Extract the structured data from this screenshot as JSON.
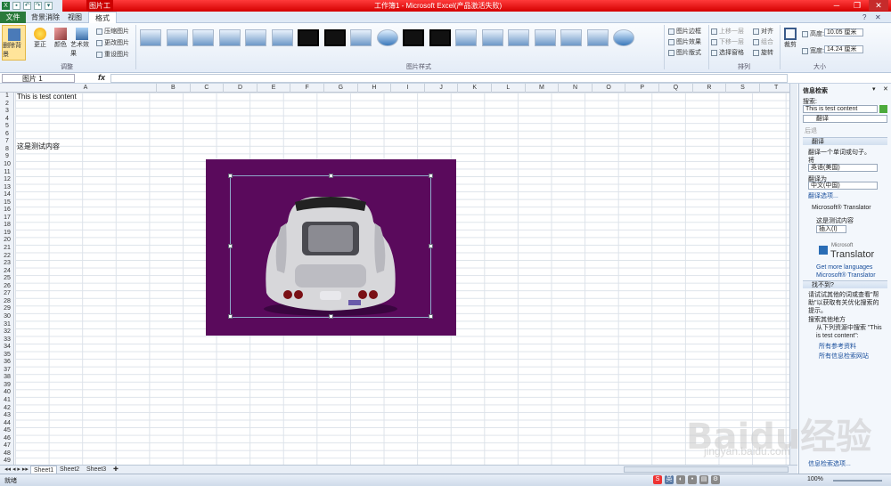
{
  "window": {
    "doc_title": "工作簿1 - Microsoft Excel(产品激活失败)",
    "context_tab": "图片工具"
  },
  "tabs": {
    "file": "文件",
    "bg_removal": "背景消除",
    "view": "视图",
    "format": "格式"
  },
  "ribbon": {
    "remove_bg": "删除背景",
    "corrections": "更正",
    "color": "颜色",
    "art_effects": "艺术效果",
    "compress": "压缩图片",
    "change": "更改图片",
    "reset": "重设图片",
    "adjust_group": "调整",
    "styles_group": "图片样式",
    "border": "图片边框",
    "effects": "图片效果",
    "layout": "图片版式",
    "bring_forward": "上移一层",
    "send_backward": "下移一层",
    "selection_pane": "选择窗格",
    "align": "对齐",
    "group": "组合",
    "rotate": "旋转",
    "arrange_group": "排列",
    "crop": "裁剪",
    "height_label": "高度:",
    "height_value": "10.05 厘米",
    "width_label": "宽度:",
    "width_value": "14.24 厘米",
    "size_group": "大小"
  },
  "formula": {
    "name_box": "图片 1",
    "fx": "fx",
    "value": ""
  },
  "columns": [
    "A",
    "B",
    "C",
    "D",
    "E",
    "F",
    "G",
    "H",
    "I",
    "J",
    "K",
    "L",
    "M",
    "N",
    "O",
    "P",
    "Q",
    "R",
    "S",
    "T"
  ],
  "rows": [
    "1",
    "2",
    "3",
    "4",
    "5",
    "6",
    "7",
    "8",
    "9",
    "10",
    "11",
    "12",
    "13",
    "14",
    "15",
    "16",
    "17",
    "18",
    "19",
    "20",
    "21",
    "22",
    "23",
    "24",
    "25",
    "26",
    "27",
    "28",
    "29",
    "30",
    "31",
    "32",
    "33",
    "34",
    "35",
    "36",
    "37",
    "38",
    "39",
    "40",
    "41",
    "42",
    "43",
    "44",
    "45",
    "46",
    "47",
    "48",
    "49"
  ],
  "cells": {
    "a1": "This is test content",
    "a7": "这是测试内容"
  },
  "sheets": [
    "Sheet1",
    "Sheet2",
    "Sheet3"
  ],
  "panel": {
    "title": "信息检索",
    "search_label": "搜索:",
    "search_value": "This is test content",
    "service": "翻译",
    "back": "后退",
    "section_translate": "翻译",
    "translate_prompt": "翻译一个单词或句子。",
    "from_label": "将",
    "from_value": "英语(美国)",
    "to_label": "翻译为",
    "to_value": "中文(中国)",
    "options_link": "翻译选项...",
    "translator_name": "Microsoft® Translator",
    "result": "这是测试内容",
    "insert": "插入(I)",
    "logo_small": "Microsoft",
    "logo_big": "Translator",
    "more_languages": "Get more languages",
    "ms_translator": "Microsoft® Translator",
    "not_found_section": "找不到?",
    "hint": "请试试其他的词或查看\"帮助\"以获取有关优化搜索的提示。",
    "other_places": "搜索其他地方",
    "search_from": "从下列资源中搜索 \"This is test content\":",
    "all_ref": "所有参考资料",
    "all_sites": "所有信息检索网站",
    "options": "信息检索选项..."
  },
  "status": {
    "ready": "就绪",
    "zoom": "100%"
  },
  "watermark": {
    "brand": "Baidu经验",
    "url": "jingyan.baidu.com"
  },
  "colors": {
    "titlebar": "#d40000",
    "picture_bg": "#5a0a5c",
    "file_tab": "#2a7a3b"
  }
}
